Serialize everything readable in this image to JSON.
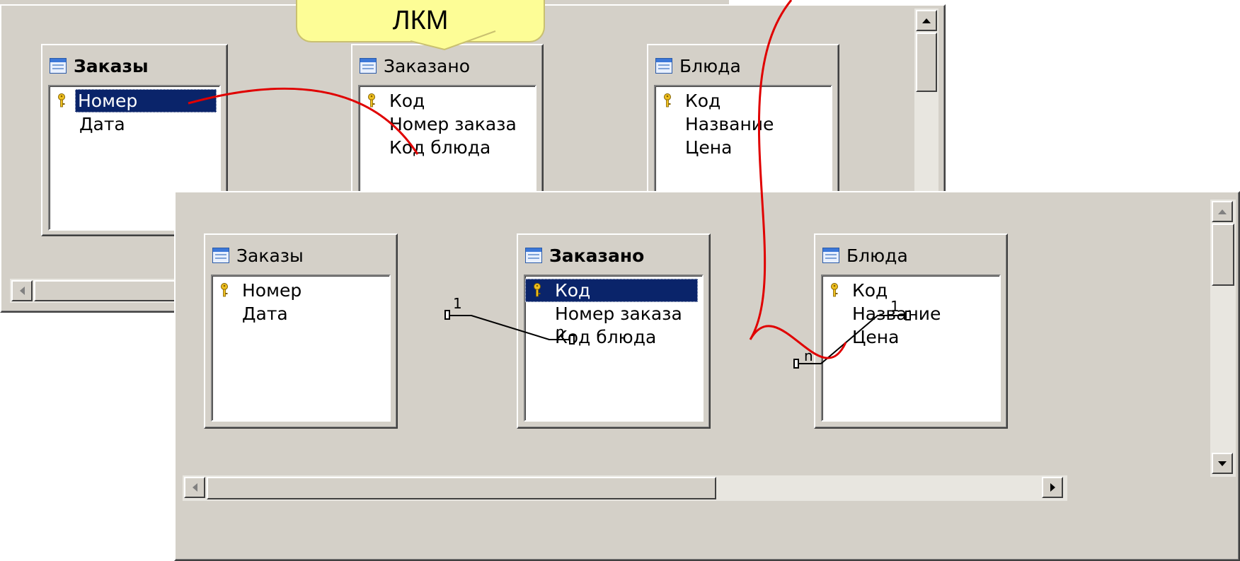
{
  "callout": {
    "label": "ЛКМ"
  },
  "back_window": {
    "tables": [
      {
        "title": "Заказы",
        "bold": true,
        "fields": [
          {
            "name": "Номер",
            "key": true,
            "selected": true
          },
          {
            "name": "Дата",
            "key": false
          }
        ]
      },
      {
        "title": "Заказано",
        "bold": false,
        "fields": [
          {
            "name": "Код",
            "key": true
          },
          {
            "name": "Номер заказа",
            "key": false
          },
          {
            "name": "Код блюда",
            "key": false
          }
        ]
      },
      {
        "title": "Блюда",
        "bold": false,
        "fields": [
          {
            "name": "Код",
            "key": true
          },
          {
            "name": "Название",
            "key": false
          },
          {
            "name": "Цена",
            "key": false
          }
        ]
      }
    ]
  },
  "front_window": {
    "tables": [
      {
        "title": "Заказы",
        "bold": false,
        "fields": [
          {
            "name": "Номер",
            "key": true
          },
          {
            "name": "Дата",
            "key": false
          }
        ]
      },
      {
        "title": "Заказано",
        "bold": true,
        "fields": [
          {
            "name": "Код",
            "key": true,
            "selected": true
          },
          {
            "name": "Номер заказа",
            "key": false
          },
          {
            "name": "Код блюда",
            "key": false
          }
        ]
      },
      {
        "title": "Блюда",
        "bold": false,
        "fields": [
          {
            "name": "Код",
            "key": true
          },
          {
            "name": "Название",
            "key": false
          },
          {
            "name": "Цена",
            "key": false
          }
        ]
      }
    ],
    "relations": [
      {
        "one": "1",
        "many": "n"
      },
      {
        "one": "1",
        "many": "n"
      }
    ]
  },
  "colors": {
    "selection": "#0a246a",
    "arrow": "#e00000",
    "callout": "#fdfd96",
    "window": "#d4d0c8"
  },
  "icons": {
    "table": "table-icon",
    "key": "key-icon",
    "scroll_left": "arrow-left-icon",
    "scroll_right": "arrow-right-icon",
    "scroll_up": "arrow-up-icon",
    "scroll_down": "arrow-down-icon"
  }
}
